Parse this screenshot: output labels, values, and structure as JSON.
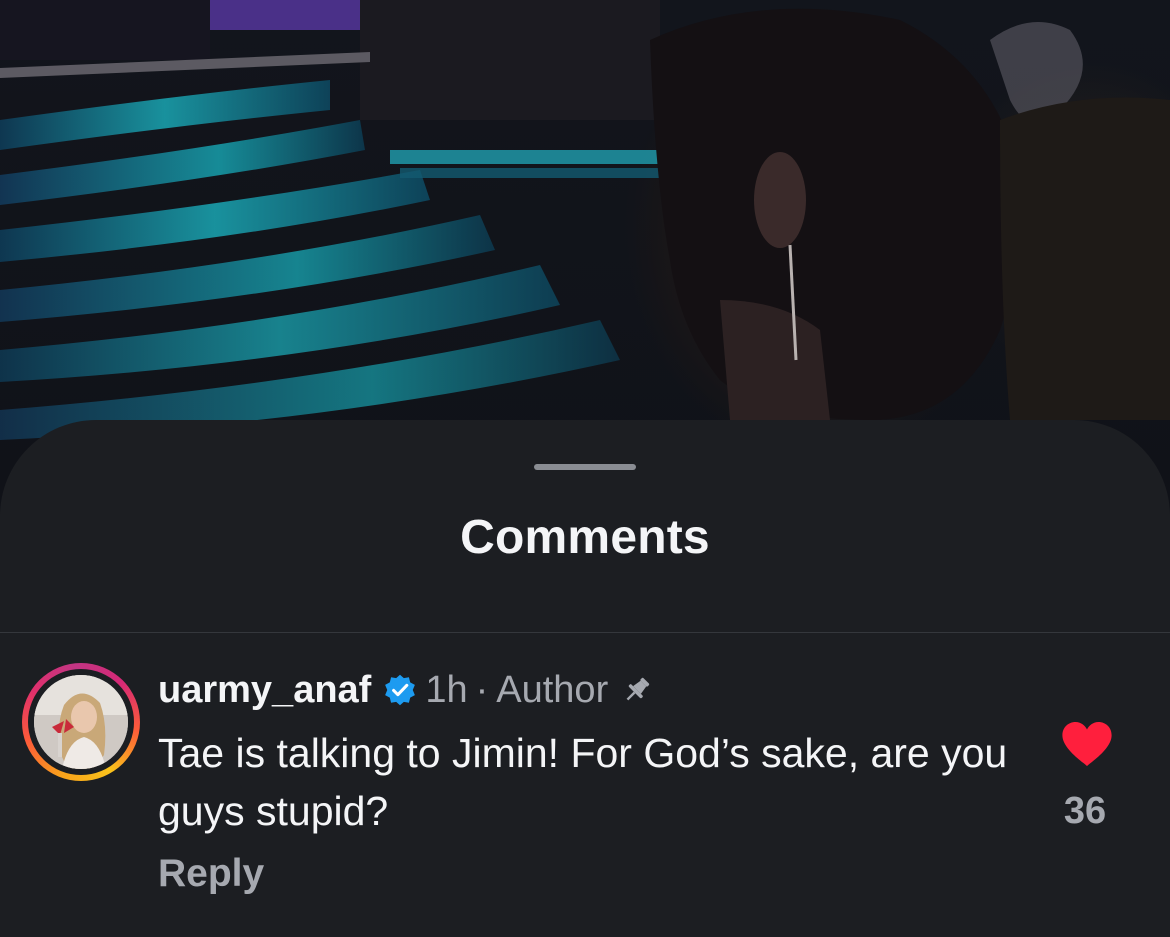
{
  "sheet": {
    "title": "Comments"
  },
  "comment": {
    "username": "uarmy_anaf",
    "verified": true,
    "time": "1h",
    "separator": "·",
    "role": "Author",
    "pinned": true,
    "text": "Tae is talking to Jimin! For God’s sake, are you guys stupid?",
    "reply_label": "Reply",
    "likes": "36",
    "liked": true
  },
  "colors": {
    "sheet_bg": "#1c1e22",
    "text_primary": "#f4f5f7",
    "text_secondary": "#a6a9b0",
    "verified_blue": "#1d9bf0",
    "like_red": "#ff1f3d"
  },
  "icons": {
    "verified": "verified-badge-icon",
    "pin": "pin-icon",
    "like": "heart-filled-icon"
  }
}
